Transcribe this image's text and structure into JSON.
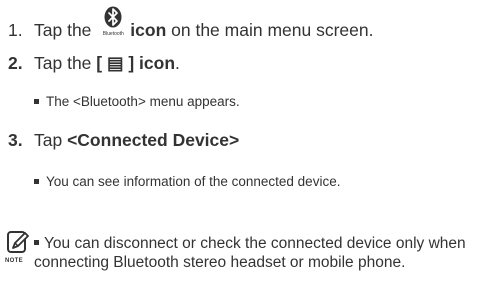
{
  "steps": [
    {
      "number": "1.",
      "pre": "Tap the ",
      "icon_caption": "Bluetooth",
      "bold": "icon",
      "post": " on the main menu screen."
    },
    {
      "number": "2.",
      "pre": "Tap the ",
      "bold": "[ ▤ ] icon",
      "post": ".",
      "sub": "The <Bluetooth> menu appears."
    },
    {
      "number": "3.",
      "pre": "Tap ",
      "bold": "<Connected Device>",
      "sub": "You can see information of the connected device."
    }
  ],
  "note": {
    "label": "NOTE",
    "text": "You can disconnect or check the connected device only when connecting Bluetooth stereo headset or mobile phone."
  },
  "icons": {
    "bluetooth": "bluetooth-icon",
    "note": "note-pencil-icon"
  },
  "colors": {
    "text": "#333333",
    "background": "#ffffff"
  }
}
